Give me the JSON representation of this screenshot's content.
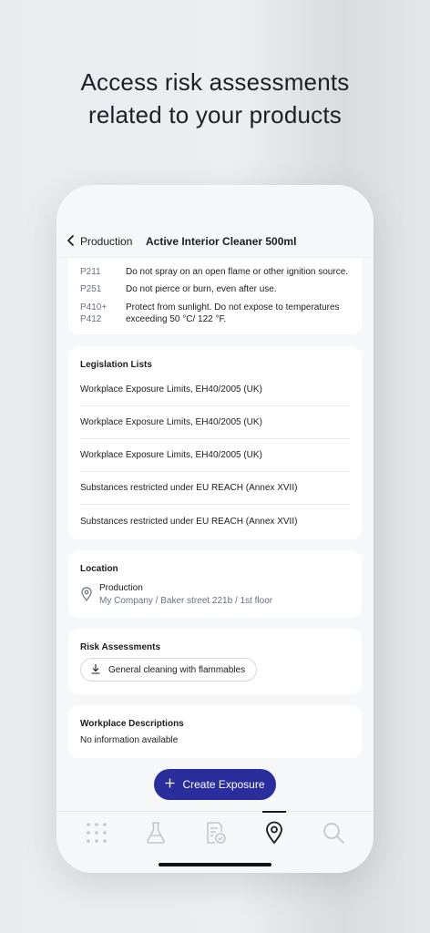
{
  "headline": {
    "line1": "Access risk assessments",
    "line2": "related to your products"
  },
  "nav": {
    "back_label": "Production",
    "title": "Active Interior Cleaner 500ml"
  },
  "precautions": [
    {
      "code": "P211",
      "text": "Do not spray on an open flame or other ignition source."
    },
    {
      "code": "P251",
      "text": "Do not pierce or burn, even after use."
    },
    {
      "code_line1": "P410+",
      "code_line2": "P412",
      "text": "Protect from sunlight. Do not expose to temperatures exceeding 50 °C/ 122 °F."
    }
  ],
  "legislation": {
    "title": "Legislation Lists",
    "items": [
      "Workplace Exposure Limits, EH40/2005 (UK)",
      "Workplace Exposure Limits, EH40/2005 (UK)",
      "Workplace Exposure Limits, EH40/2005 (UK)",
      "Substances restricted under EU REACH (Annex XVII)",
      "Substances restricted under EU REACH (Annex XVII)"
    ]
  },
  "location": {
    "title": "Location",
    "name": "Production",
    "path": "My Company / Baker street 221b / 1st floor"
  },
  "risk_assessments": {
    "title": "Risk Assessments",
    "chip_label": "General cleaning with flammables"
  },
  "workplace_descriptions": {
    "title": "Workplace Descriptions",
    "empty_text": "No information available"
  },
  "create_button": {
    "label": "Create Exposure"
  },
  "colors": {
    "accent": "#2a2e9c",
    "muted_text": "#6a7080",
    "inactive_icon": "#b8bcc6"
  },
  "tabs": [
    {
      "icon": "grid-icon",
      "active": false
    },
    {
      "icon": "flask-icon",
      "active": false
    },
    {
      "icon": "document-check-icon",
      "active": false
    },
    {
      "icon": "location-pin-icon",
      "active": true
    },
    {
      "icon": "search-icon",
      "active": false
    }
  ]
}
